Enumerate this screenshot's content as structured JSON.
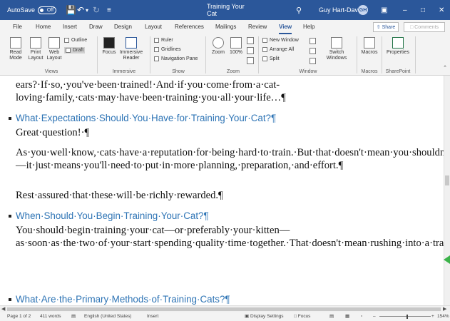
{
  "titlebar": {
    "autosave_label": "AutoSave",
    "autosave_state": "Off",
    "doc_title": "Training Your Cat",
    "user_name": "Guy Hart-Davis",
    "user_initials": "GH"
  },
  "tabs": [
    "File",
    "Home",
    "Insert",
    "Draw",
    "Design",
    "Layout",
    "References",
    "Mailings",
    "Review",
    "View",
    "Help"
  ],
  "active_tab": "View",
  "share_label": "Share",
  "comments_label": "Comments",
  "ribbon": {
    "views": {
      "read_mode": "Read Mode",
      "print_layout": "Print Layout",
      "web_layout": "Web Layout",
      "outline": "Outline",
      "draft": "Draft",
      "group": "Views"
    },
    "immersive": {
      "focus": "Focus",
      "reader": "Immersive Reader",
      "group": "Immersive"
    },
    "show": {
      "ruler": "Ruler",
      "gridlines": "Gridlines",
      "nav_pane": "Navigation Pane",
      "group": "Show"
    },
    "zoom": {
      "zoom": "Zoom",
      "hundred": "100%",
      "group": "Zoom"
    },
    "window": {
      "new_window": "New Window",
      "arrange_all": "Arrange All",
      "split": "Split",
      "switch_windows": "Switch Windows",
      "group": "Window"
    },
    "macros": {
      "macros": "Macros",
      "group": "Macros"
    },
    "sharepoint": {
      "properties": "Properties",
      "group": "SharePoint"
    }
  },
  "document": {
    "p_top": "ears?·If·so,·you've·been·trained!·And·if·you·come·from·a·cat-loving·family,·cats·may·have·been·training·you·all·your·life…¶",
    "h1": "What·Expectations·Should·You·Have·for·Training·Your·Cat?¶",
    "p1": "Great·question!·¶",
    "p2": "As·you·well·know,·cats·have·a·reputation·for·being·hard·to·train.·But·that·doesn't·mean·you·shouldn't·try—it·just·means·you'll·need·to·put·in·more·planning,·preparation,·and·effort.¶",
    "p3": "Rest·assured·that·these·will·be·richly·rewarded.¶",
    "h2": "When·Should·You·Begin·Training·Your·Cat?¶",
    "p4": "You·should·begin·training·your·cat—or·preferably·your·kitten—as·soon·as·the·two·of·your·start·spending·quality·time·together.·That·doesn't·mean·rushing·into·a·training·session·the·moment·you·first·let·your·cat·out·of·the·travel·container·you·use·to·bring·him·to·your·home.·Instead,·give·your·cat·time·to·settle·and·to·explore·its·immediate·environment.¶",
    "h3": "What·Are·the·Primary·Methods·of·Training·Cats?¶"
  },
  "statusbar": {
    "page": "Page 1 of 2",
    "words": "411 words",
    "language": "English (United States)",
    "mode": "Insert",
    "display_settings": "Display Settings",
    "focus": "Focus",
    "zoom": "154%"
  },
  "colors": {
    "accent": "#2b579a",
    "heading": "#2e74b5",
    "marker": "#3cb34a"
  }
}
